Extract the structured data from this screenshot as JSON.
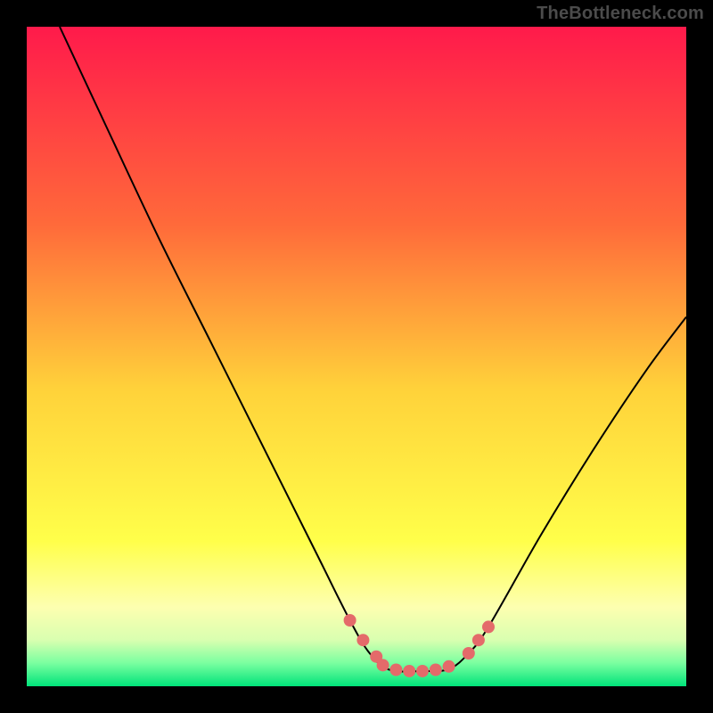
{
  "watermark": "TheBottleneck.com",
  "chart_data": {
    "type": "line",
    "title": "",
    "xlabel": "",
    "ylabel": "",
    "x_range": [
      0,
      100
    ],
    "y_range": [
      0,
      100
    ],
    "background": {
      "type": "vertical_gradient",
      "stops": [
        {
          "offset": 0,
          "color": "#ff1a4b"
        },
        {
          "offset": 0.3,
          "color": "#ff6a3a"
        },
        {
          "offset": 0.55,
          "color": "#ffd23a"
        },
        {
          "offset": 0.78,
          "color": "#ffff4a"
        },
        {
          "offset": 0.88,
          "color": "#fdffb0"
        },
        {
          "offset": 0.93,
          "color": "#d9ffb0"
        },
        {
          "offset": 0.965,
          "color": "#7affa0"
        },
        {
          "offset": 1.0,
          "color": "#00e37a"
        }
      ]
    },
    "series": [
      {
        "name": "bottleneck-curve",
        "color": "#000000",
        "stroke_width": 2,
        "points": [
          {
            "x": 5,
            "y": 100
          },
          {
            "x": 12,
            "y": 85
          },
          {
            "x": 20,
            "y": 68
          },
          {
            "x": 28,
            "y": 52
          },
          {
            "x": 36,
            "y": 36
          },
          {
            "x": 44,
            "y": 20
          },
          {
            "x": 49,
            "y": 10
          },
          {
            "x": 52,
            "y": 5
          },
          {
            "x": 55,
            "y": 2.5
          },
          {
            "x": 60,
            "y": 2.3
          },
          {
            "x": 64,
            "y": 2.6
          },
          {
            "x": 67,
            "y": 5
          },
          {
            "x": 70,
            "y": 9
          },
          {
            "x": 78,
            "y": 23
          },
          {
            "x": 86,
            "y": 36
          },
          {
            "x": 94,
            "y": 48
          },
          {
            "x": 100,
            "y": 56
          }
        ]
      }
    ],
    "markers": {
      "name": "highlight-dots",
      "color": "#e46a6a",
      "radius_px": 7,
      "points": [
        {
          "x": 49,
          "y": 10
        },
        {
          "x": 51,
          "y": 7
        },
        {
          "x": 53,
          "y": 4.5
        },
        {
          "x": 54,
          "y": 3.2
        },
        {
          "x": 56,
          "y": 2.5
        },
        {
          "x": 58,
          "y": 2.3
        },
        {
          "x": 60,
          "y": 2.3
        },
        {
          "x": 62,
          "y": 2.5
        },
        {
          "x": 64,
          "y": 3.0
        },
        {
          "x": 67,
          "y": 5
        },
        {
          "x": 68.5,
          "y": 7
        },
        {
          "x": 70,
          "y": 9
        }
      ]
    }
  }
}
